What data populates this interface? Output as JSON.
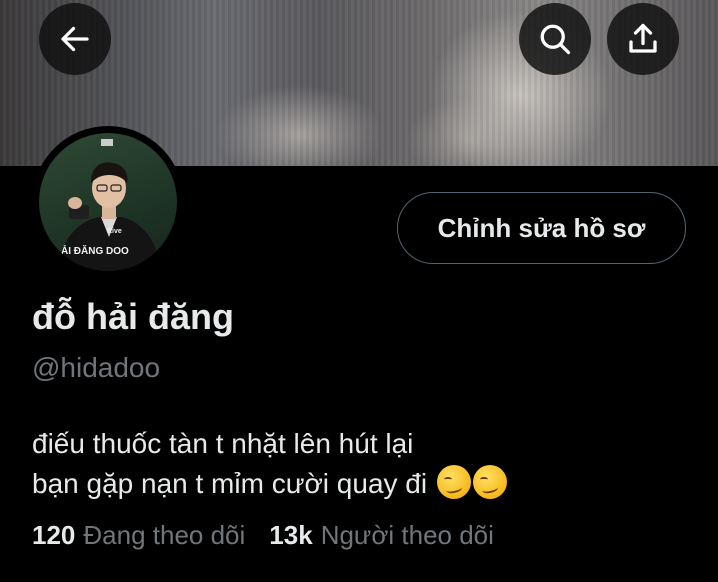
{
  "header": {
    "back_icon": "arrow-left-icon",
    "search_icon": "search-icon",
    "share_icon": "share-upload-icon"
  },
  "avatar": {
    "overlay_text": "ẢI ĐĂNG DOO",
    "small_logo": "Rive"
  },
  "profile": {
    "edit_button_label": "Chỉnh sửa hồ sơ",
    "display_name": "đỗ hải đăng",
    "handle": "@hidadoo",
    "bio_line1": "điếu thuốc tàn t nhặt lên hút lại",
    "bio_line2": "bạn gặp nạn t mỉm cười quay đi",
    "bio_emoji": "smirking-face-emoji"
  },
  "stats": {
    "following_count": "120",
    "following_label": "Đang theo dõi",
    "followers_count": "13k",
    "followers_label": "Người theo dõi"
  },
  "colors": {
    "background": "#000000",
    "primary_text": "#e7e9ea",
    "secondary_text": "#71767b",
    "button_border": "#536471"
  }
}
